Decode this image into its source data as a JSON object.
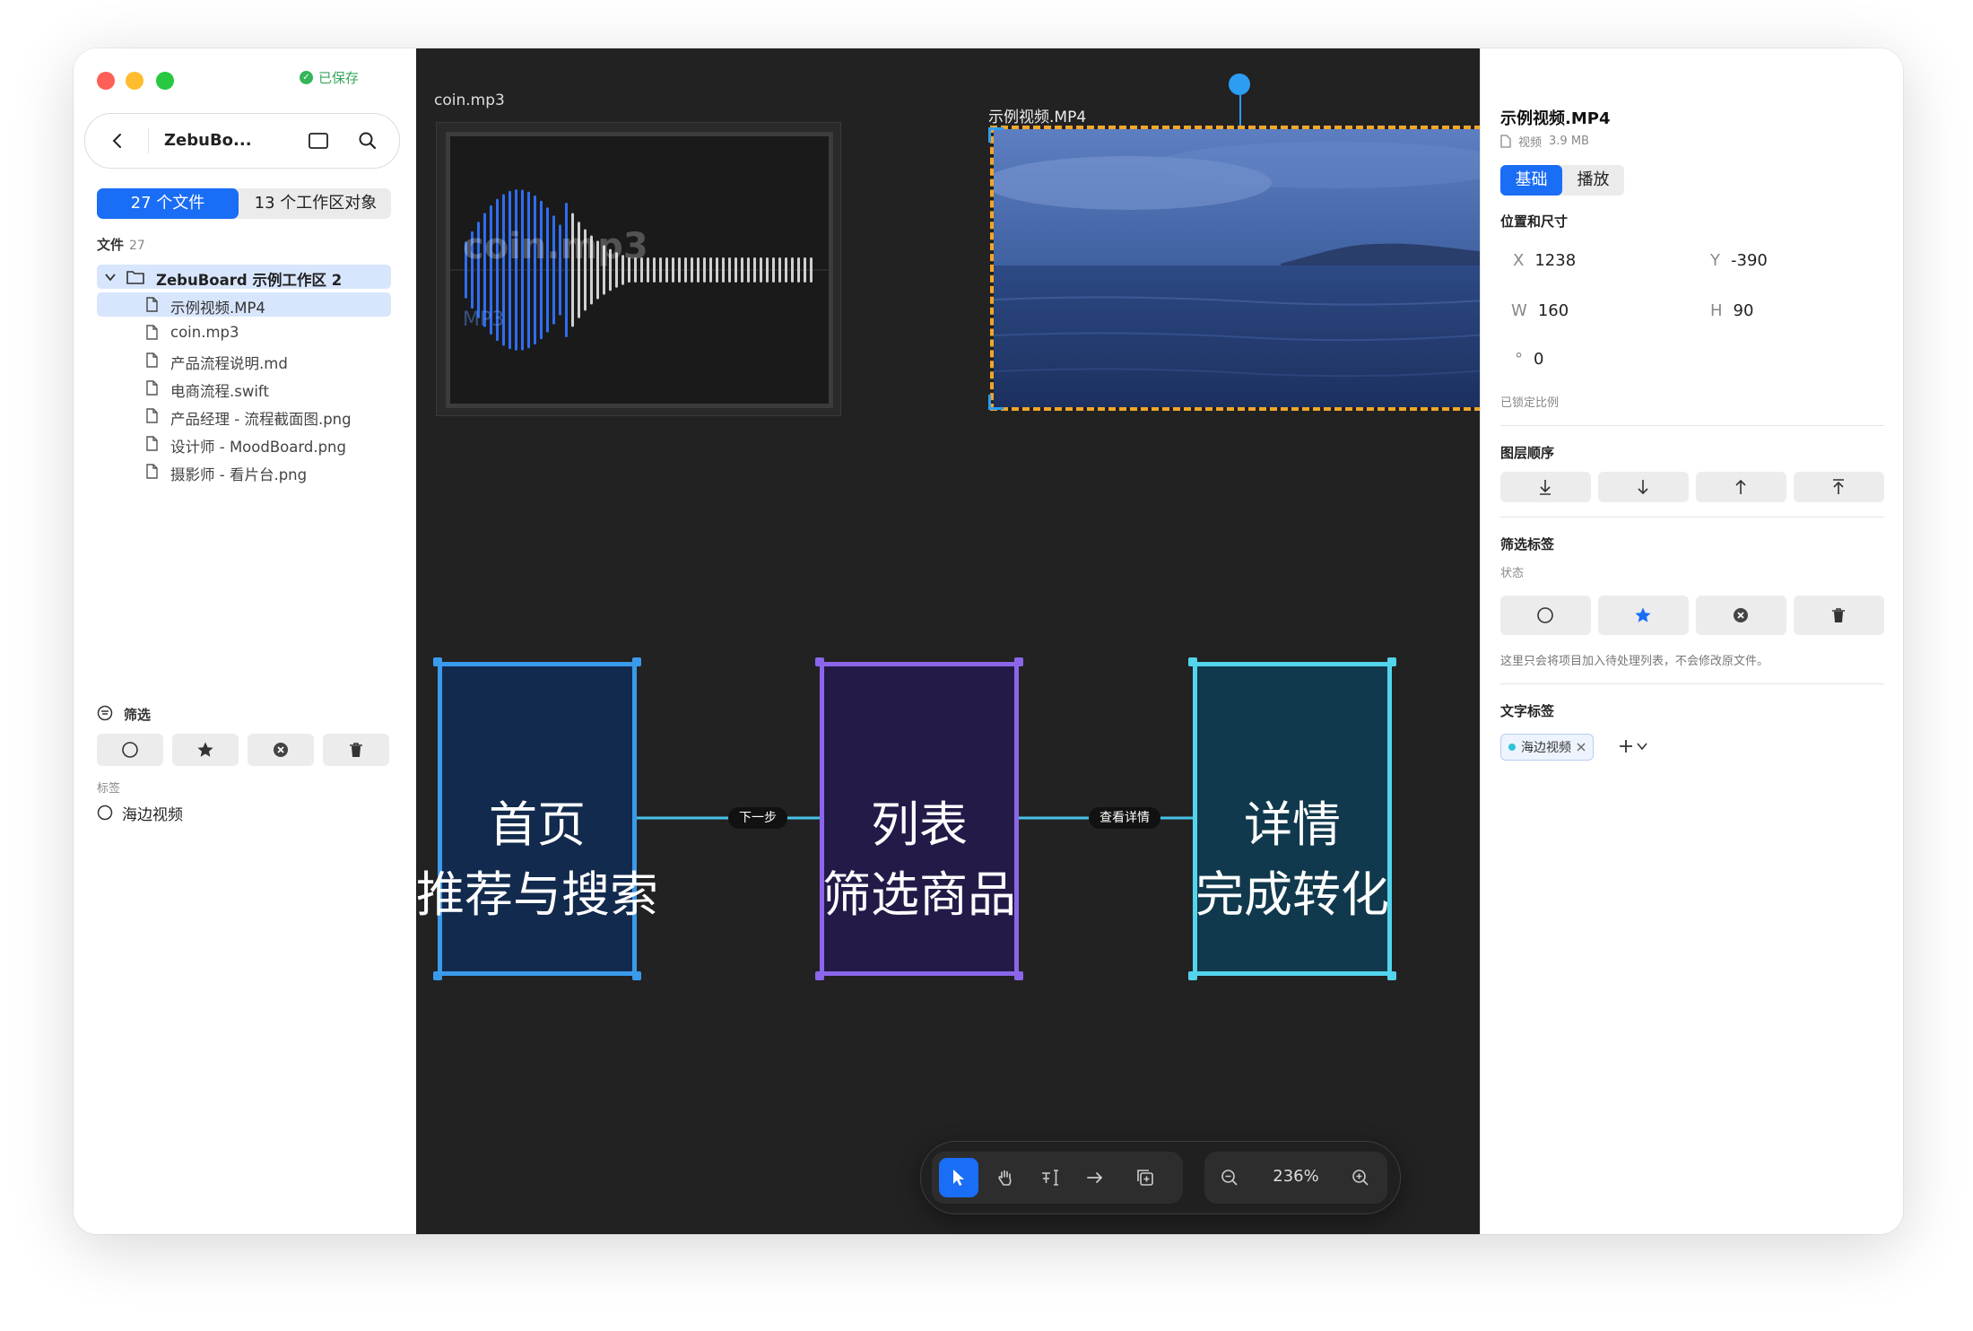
{
  "window": {
    "save_status": "已保存",
    "project_title": "ZebuBo...",
    "colors": {
      "accent": "#1a6df5",
      "close": "#fe5f57",
      "minimize": "#febc2e",
      "zoom": "#28c840"
    }
  },
  "sidebar": {
    "tabs": [
      {
        "label": "27 个文件",
        "active": true
      },
      {
        "label": "13 个工作区对象",
        "active": false
      }
    ],
    "files_heading": "文件",
    "files_count": "27",
    "tree": [
      {
        "label": "ZebuBoard 示例工作区 2",
        "type": "folder",
        "selected": true
      },
      {
        "label": "示例视频.MP4",
        "type": "file",
        "selected": true
      },
      {
        "label": "coin.mp3",
        "type": "file"
      },
      {
        "label": "产品流程说明.md",
        "type": "file"
      },
      {
        "label": "电商流程.swift",
        "type": "file"
      },
      {
        "label": "产品经理 - 流程截面图.png",
        "type": "file"
      },
      {
        "label": "设计师 - MoodBoard.png",
        "type": "file"
      },
      {
        "label": "摄影师 - 看片台.png",
        "type": "file"
      }
    ],
    "filter_heading": "筛选",
    "filter_buttons": [
      "circle-icon",
      "star-icon",
      "x-circle-icon",
      "trash-icon"
    ],
    "tags_heading": "标签",
    "tags": [
      {
        "label": "海边视频",
        "checked": false
      }
    ]
  },
  "canvas": {
    "audio": {
      "name": "coin.mp3",
      "overlay_title": "coin.mp3",
      "overlay_sub": "MP3"
    },
    "video": {
      "name": "示例视频.MP4"
    },
    "flow": {
      "nodes": [
        {
          "line1": "首页",
          "line2": "推荐与搜索",
          "color": "#3a9aec",
          "fill": "#122a4d"
        },
        {
          "line1": "列表",
          "line2": "筛选商品",
          "color": "#8b66ea",
          "fill": "#231a48"
        },
        {
          "line1": "详情",
          "line2": "完成转化",
          "color": "#52d4ec",
          "fill": "#11394d"
        }
      ],
      "edges": [
        {
          "label": "下一步"
        },
        {
          "label": "查看详情"
        }
      ]
    },
    "toolbar": {
      "tools": [
        "cursor-icon",
        "hand-icon",
        "text-icon",
        "arrow-icon",
        "duplicate-icon"
      ],
      "active_tool": "cursor-icon",
      "zoom": "236%"
    }
  },
  "inspector": {
    "title": "示例视频.MP4",
    "kind": "视频",
    "size": "3.9 MB",
    "tabs": [
      {
        "label": "基础",
        "active": true
      },
      {
        "label": "播放",
        "active": false
      }
    ],
    "position_heading": "位置和尺寸",
    "x_label": "X",
    "x": "1238",
    "y_label": "Y",
    "y": "-390",
    "w_label": "W",
    "w": "160",
    "h_label": "H",
    "h": "90",
    "rotation_symbol": "°",
    "rotation": "0",
    "ratio_locked": "已锁定比例",
    "layer_heading": "图层顺序",
    "layer_buttons": [
      "send-to-back-icon",
      "send-backward-icon",
      "bring-forward-icon",
      "bring-to-front-icon"
    ],
    "status_heading": "筛选标签",
    "status_sub": "状态",
    "status_buttons": [
      "circle-icon",
      "star-icon",
      "x-circle-icon",
      "trash-icon"
    ],
    "status_note": "这里只会将项目加入待处理列表，不会修改原文件。",
    "text_tags_heading": "文字标签",
    "tag_chip": "海边视频"
  }
}
